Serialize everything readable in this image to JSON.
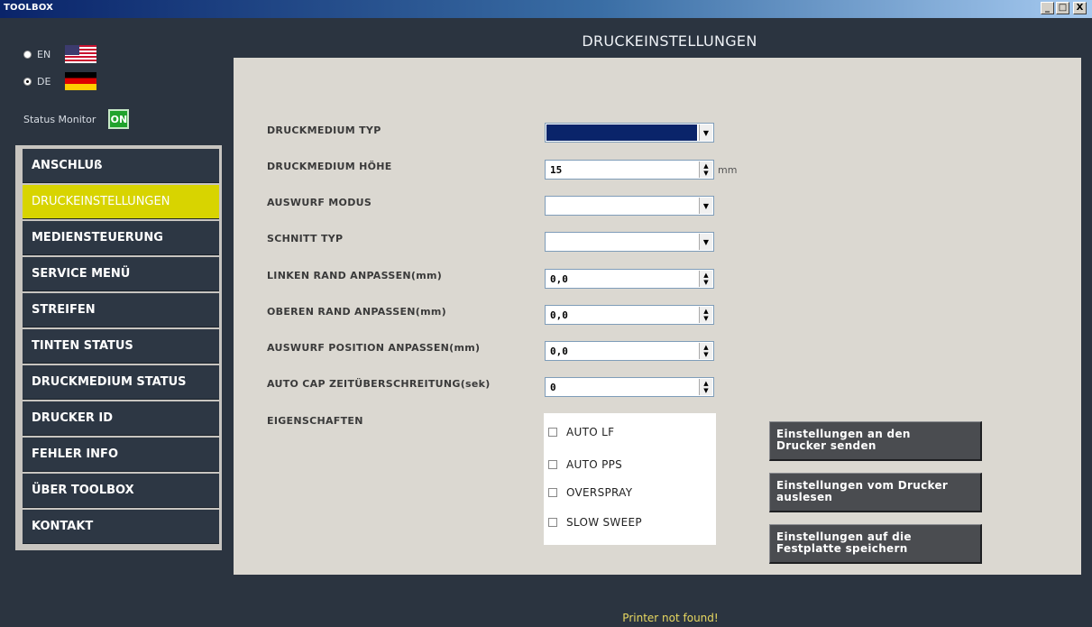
{
  "window": {
    "title": "TOOLBOX",
    "controls": [
      "_",
      "□",
      "X"
    ]
  },
  "language": [
    {
      "code": "EN",
      "flag": "us-flag-icon",
      "selected": false
    },
    {
      "code": "DE",
      "flag": "de-flag-icon",
      "selected": true
    }
  ],
  "status": {
    "label": "Status Monitor",
    "badge": "ON",
    "badge_color": "#21a32d"
  },
  "menu": {
    "items": [
      {
        "label": "ANSCHLUß",
        "active": false
      },
      {
        "label": "DRUCKEINSTELLUNGEN",
        "active": true
      },
      {
        "label": "MEDIENSTEUERUNG",
        "active": false
      },
      {
        "label": "SERVICE MENÜ",
        "active": false
      },
      {
        "label": "STREIFEN",
        "active": false
      },
      {
        "label": "TINTEN STATUS",
        "active": false
      },
      {
        "label": "DRUCKMEDIUM STATUS",
        "active": false
      },
      {
        "label": "DRUCKER ID",
        "active": false
      },
      {
        "label": "FEHLER INFO",
        "active": false
      },
      {
        "label": "ÜBER TOOLBOX",
        "active": false
      },
      {
        "label": "KONTAKT",
        "active": false
      }
    ],
    "active_color": "#d8d400"
  },
  "page": {
    "heading": "DRUCKEINSTELLUNGEN"
  },
  "fields": [
    {
      "label": "DRUCKMEDIUM TYP",
      "kind": "select",
      "value": "",
      "highlighted": true
    },
    {
      "label": "DRUCKMEDIUM HÖHE",
      "kind": "spin",
      "value": "15",
      "unit": "mm"
    },
    {
      "label": "AUSWURF MODUS",
      "kind": "select",
      "value": ""
    },
    {
      "label": "SCHNITT TYP",
      "kind": "select",
      "value": ""
    },
    {
      "label": "LINKEN RAND ANPASSEN(mm)",
      "kind": "spin",
      "value": "0,0"
    },
    {
      "label": "OBEREN RAND ANPASSEN(mm)",
      "kind": "spin",
      "value": "0,0"
    },
    {
      "label": "AUSWURF POSITION ANPASSEN(mm)",
      "kind": "spin",
      "value": "0,0"
    },
    {
      "label": "AUTO CAP ZEITÜBERSCHREITUNG(sek)",
      "kind": "spin",
      "value": "0"
    }
  ],
  "properties": {
    "label": "EIGENSCHAFTEN",
    "options": [
      {
        "label": "AUTO LF",
        "checked": false
      },
      {
        "label": "AUTO PPS",
        "checked": false
      },
      {
        "label": "OVERSPRAY",
        "checked": false
      },
      {
        "label": "SLOW SWEEP",
        "checked": false
      }
    ]
  },
  "actions": [
    {
      "line1": "Einstellungen an den",
      "line2": "Drucker senden"
    },
    {
      "line1": "Einstellungen vom Drucker",
      "line2": "auslesen"
    },
    {
      "line1": "Einstellungen auf die",
      "line2": "Festplatte speichern"
    }
  ],
  "footer": {
    "message": "Printer not found!",
    "color": "#e8d860"
  }
}
